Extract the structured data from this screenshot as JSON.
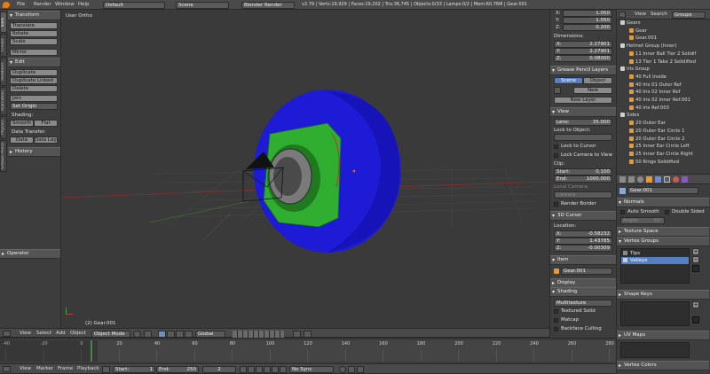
{
  "topbar": {
    "menus": [
      "File",
      "Render",
      "Window",
      "Help"
    ],
    "screen": "Default",
    "scene": "Scene",
    "engine": "Blender Render",
    "stats": "v2.79 | Verts:19,929 | Faces:19,202 | Tris:36,745 | Objects:0/33 | Lamps:0/2 | Mem:60.76M | Gear.001"
  },
  "toolshelf": {
    "tabs": [
      "Tools",
      "Create",
      "Relations",
      "Animation",
      "Physics",
      "Grease Pencil"
    ],
    "transform_header": "Transform",
    "translate": "Translate",
    "rotate": "Rotate",
    "scale": "Scale",
    "mirror": "Mirror",
    "edit_header": "Edit",
    "duplicate": "Duplicate",
    "duplicate_linked": "Duplicate Linked",
    "delete": "Delete",
    "join": "Join",
    "set_origin": "Set Origin",
    "shading_label": "Shading:",
    "smooth": "Smooth",
    "flat": "Flat",
    "data_transfer_label": "Data Transfer:",
    "data": "Data",
    "data_layo": "Data Layo",
    "history_header": "History",
    "operator_header": "Operator"
  },
  "viewport": {
    "label": "User Ortho",
    "object_label": "(2) Gear.001"
  },
  "vheader": {
    "view": "View",
    "select": "Select",
    "add": "Add",
    "object": "Object",
    "mode": "Object Mode",
    "orientation": "Global"
  },
  "npanel": {
    "loc_x_label": "X:",
    "loc_x": "1.050",
    "loc_y_label": "Y:",
    "loc_y": "1.050",
    "loc_z_label": "Z:",
    "loc_z": "0.200",
    "dimensions_label": "Dimensions:",
    "dim_x": "2.27901",
    "dim_y": "2.27901",
    "dim_z": "0.08000",
    "grease_header": "Grease Pencil Layers",
    "gp_scene": "Scene",
    "gp_object": "Object",
    "gp_new": "New",
    "gp_new_layer": "New Layer",
    "view_header": "View",
    "lens_label": "Lens:",
    "lens": "35.000",
    "lock_to_object": "Lock to Object:",
    "lock_to_cursor": "Lock to Cursor",
    "lock_camera": "Lock Camera to View",
    "clip_label": "Clip:",
    "clip_start_label": "Start:",
    "clip_start": "0.100",
    "clip_end_label": "End:",
    "clip_end": "1000.000",
    "local_camera": "Local Camera:",
    "camera": "Camera",
    "render_border": "Render Border",
    "cursor_header": "3D Cursor",
    "location_label": "Location:",
    "cur_x": "-0.58232",
    "cur_y": "1.43785",
    "cur_z": "-0.00309",
    "item_header": "Item",
    "item_name": "Gear.001",
    "display_header": "Display",
    "shading_header": "Shading",
    "shading_mode": "Multitexture",
    "textured_solid": "Textured Solid",
    "matcap": "Matcap",
    "backface": "Backface Culling"
  },
  "outliner": {
    "tabs": [
      "View",
      "Search",
      "Groups"
    ],
    "items": [
      {
        "text": "Gears",
        "indent": 0,
        "color": "#cfcfcf"
      },
      {
        "text": "Gear",
        "indent": 2,
        "color": "#e59a39"
      },
      {
        "text": "Gear.001",
        "indent": 2,
        "color": "#e59a39"
      },
      {
        "text": "Helmet Group (Inner)",
        "indent": 0,
        "color": "#cfcfcf"
      },
      {
        "text": "11 Inner Ball Tier 2 Solidif",
        "indent": 2,
        "color": "#e59a39"
      },
      {
        "text": "13 Tier 1 Take 2 Solidified",
        "indent": 2,
        "color": "#e59a39"
      },
      {
        "text": "Iris Group",
        "indent": 0,
        "color": "#cfcfcf"
      },
      {
        "text": "40 Full Inside",
        "indent": 2,
        "color": "#e59a39"
      },
      {
        "text": "40 Iris 01 Outer Ref",
        "indent": 2,
        "color": "#e59a39"
      },
      {
        "text": "40 Iris 02 Inner Ref",
        "indent": 2,
        "color": "#e59a39"
      },
      {
        "text": "40 Iris 02 Inner Ref.001",
        "indent": 2,
        "color": "#e59a39"
      },
      {
        "text": "40 Iris Ref.003",
        "indent": 2,
        "color": "#e59a39"
      },
      {
        "text": "Sides",
        "indent": 0,
        "color": "#cfcfcf"
      },
      {
        "text": "20 Outer Ear",
        "indent": 2,
        "color": "#e59a39"
      },
      {
        "text": "20 Outer Ear Circle 1",
        "indent": 2,
        "color": "#e59a39"
      },
      {
        "text": "20 Outer Ear Circle 2",
        "indent": 2,
        "color": "#e59a39"
      },
      {
        "text": "25 Inner Ear Circle Left",
        "indent": 2,
        "color": "#e59a39"
      },
      {
        "text": "25 Inner Ear Circle Right",
        "indent": 2,
        "color": "#e59a39"
      },
      {
        "text": "50 Rings Solidified",
        "indent": 2,
        "color": "#e59a39"
      }
    ]
  },
  "properties": {
    "mesh_name": "Gear.001",
    "normals_header": "Normals",
    "auto_smooth": "Auto Smooth",
    "double_sided": "Double Sided",
    "angle_label": "Angle:",
    "angle": "30°",
    "texture_space_header": "Texture Space",
    "vertex_groups_header": "Vertex Groups",
    "vgroups": [
      "Tips",
      "Valleys"
    ],
    "shape_keys_header": "Shape Keys",
    "uv_maps_header": "UV Maps",
    "vertex_colors_header": "Vertex Colors"
  },
  "timeline": {
    "view": "View",
    "marker": "Marker",
    "frame": "Frame",
    "playback": "Playback",
    "start_label": "Start:",
    "start": "1",
    "end_label": "End:",
    "end": "250",
    "current": "2",
    "sync": "No Sync",
    "ticks": [
      "-40",
      "-20",
      "0",
      "20",
      "40",
      "60",
      "80",
      "100",
      "120",
      "140",
      "160",
      "180",
      "200",
      "220",
      "240",
      "260",
      "280"
    ],
    "current_frame_pct": 0.147
  }
}
